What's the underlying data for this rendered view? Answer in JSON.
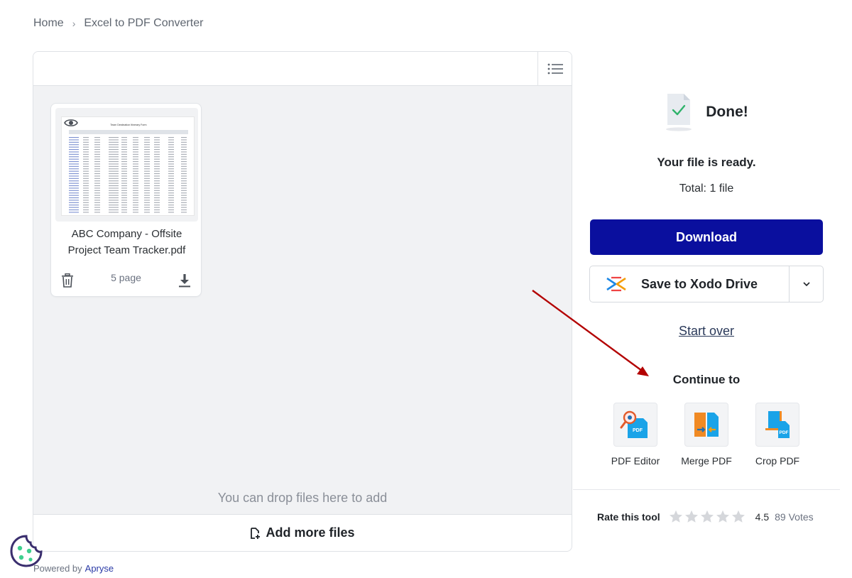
{
  "breadcrumb": {
    "home": "Home",
    "separator": "›",
    "current": "Excel to PDF Converter"
  },
  "file": {
    "name": "ABC Company - Offsite Project Team Tracker.pdf",
    "pages": "5 page",
    "thumbnail_title": "Team Destination Itinerary Form"
  },
  "drop_hint": "You can drop files here to add",
  "add_more_label": "Add more files",
  "powered": {
    "label": "Powered by",
    "brand": "Apryse"
  },
  "result": {
    "title": "Done!",
    "ready": "Your file is ready.",
    "total": "Total: 1 file",
    "download_label": "Download",
    "save_drive_label": "Save to Xodo Drive",
    "start_over_label": "Start over"
  },
  "continue_to": {
    "heading": "Continue to",
    "tools": [
      {
        "label": "PDF Editor",
        "icon": "pdf-editor-icon"
      },
      {
        "label": "Merge PDF",
        "icon": "merge-pdf-icon"
      },
      {
        "label": "Crop PDF",
        "icon": "crop-pdf-icon"
      }
    ]
  },
  "rating": {
    "label": "Rate this tool",
    "score": "4.5",
    "votes": "89 Votes",
    "stars": 5
  },
  "colors": {
    "primary": "#0a0f9e",
    "annotation_arrow": "#b30000",
    "panel_bg": "#f1f2f4"
  }
}
